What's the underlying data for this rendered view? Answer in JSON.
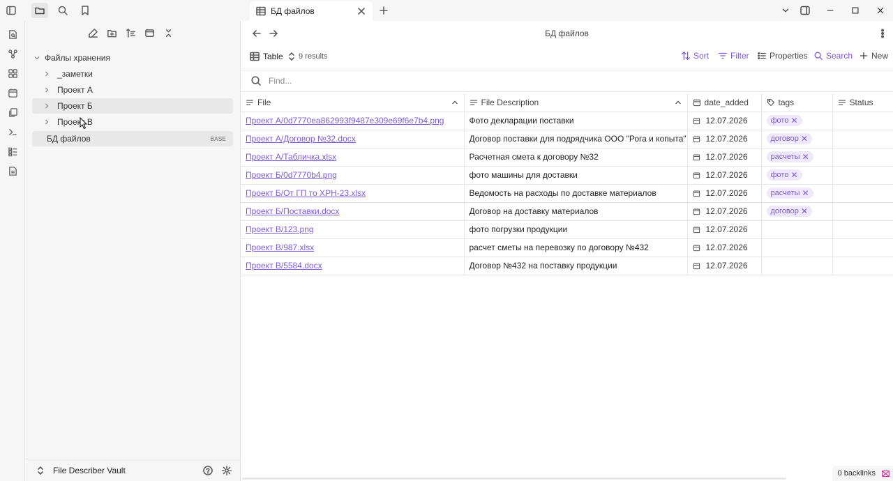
{
  "titlebar": {
    "tab_title": "БД файлов",
    "icons": [
      "sidebar-toggle-icon",
      "folder-icon",
      "search-icon",
      "bookmark-icon",
      "close-icon",
      "plus-icon",
      "chevron-down-icon",
      "split-icon",
      "minimize-icon",
      "maximize-icon",
      "close-window-icon"
    ]
  },
  "ribbon": {
    "icons": [
      "open-quick-switcher-icon",
      "graph-icon",
      "canvas-icon",
      "calendar-icon",
      "templates-icon",
      "terminal-icon",
      "bases-icon",
      "document-icon"
    ]
  },
  "sidebar": {
    "toolbar_icons": [
      "new-note-icon",
      "new-folder-icon",
      "sort-icon",
      "collapse-all-icon",
      "close-icon"
    ],
    "tree": {
      "root": "Файлы хранения",
      "children": [
        "_заметки",
        "Проект А",
        "Проект Б",
        "Проект В"
      ],
      "base_file": "БД файлов",
      "base_badge": "BASE"
    },
    "vault_name": "File Describer Vault"
  },
  "main": {
    "title": "БД файлов",
    "view_name": "Table",
    "results": "9 results",
    "tools": {
      "sort": "Sort",
      "filter": "Filter",
      "properties": "Properties",
      "search": "Search",
      "new": "New"
    },
    "find_placeholder": "Find...",
    "columns": [
      "File",
      "File Description",
      "date_added",
      "tags",
      "Status"
    ],
    "rows": [
      {
        "file": "Проект А/0d7770ea862993f9487e309e69f6e7b4.png",
        "desc": "Фото декларации поставки",
        "date": "12.07.2026",
        "tag": "фото"
      },
      {
        "file": "Проект А/Договор №32.docx",
        "desc": "Договор поставки для подрядчика ООО \"Рога и копыта\"",
        "date": "12.07.2026",
        "tag": "договор"
      },
      {
        "file": "Проект А/Табличка.xlsx",
        "desc": "Расчетная смета к договору №32",
        "date": "12.07.2026",
        "tag": "расчеты"
      },
      {
        "file": "Проект Б/0d7770b4.png",
        "desc": "фото машины для доставки",
        "date": "12.07.2026",
        "tag": "фото"
      },
      {
        "file": "Проект Б/От ГП то ХРН-23.xlsx",
        "desc": "Ведомость на расходы по доставке материалов",
        "date": "12.07.2026",
        "tag": "расчеты"
      },
      {
        "file": "Проект Б/Поставки.docx",
        "desc": "Договор на доставку материалов",
        "date": "12.07.2026",
        "tag": "договор"
      },
      {
        "file": "Проект В/123.png",
        "desc": "фото погрузки продукции",
        "date": "12.07.2026",
        "tag": ""
      },
      {
        "file": "Проект В/987.xlsx",
        "desc": "расчет сметы на перевозку по договору №432",
        "date": "12.07.2026",
        "tag": ""
      },
      {
        "file": "Проект В/5584.docx",
        "desc": "Договор №432 на поставку продукции",
        "date": "12.07.2026",
        "tag": ""
      }
    ]
  },
  "status_bar": {
    "backlinks": "0 backlinks"
  },
  "colors": {
    "accent": "#7c5cd6",
    "tag_bg": "#efe9fb",
    "sidebar_bg": "#f6f6f6"
  }
}
